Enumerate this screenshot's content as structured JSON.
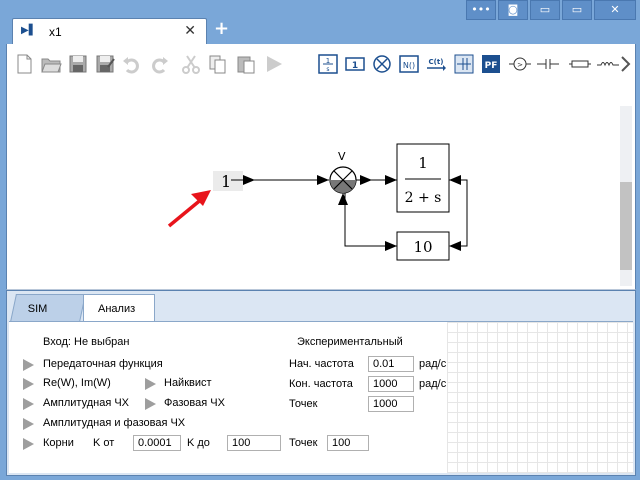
{
  "window": {
    "tab_icon": "▶▌",
    "tab_title": "x1",
    "tab_close": "✕",
    "new_tab": "+",
    "buttons": [
      "•••",
      "◙",
      "▭",
      "▭",
      "✕"
    ]
  },
  "diagram": {
    "input_value": "1",
    "sum_label": "V",
    "tf_numerator": "1",
    "tf_denominator": "2 + s",
    "feedback_gain": "10"
  },
  "tabs": {
    "sim": "SIM",
    "analysis": "Анализ"
  },
  "analysis": {
    "input_label": "Вход: Не выбран",
    "experimental_label": "Экспериментальный",
    "transfer_function": "Передаточная функция",
    "re_im": "Re(W), Im(W)",
    "nyquist": "Найквист",
    "amplitude": "Амплитудная ЧХ",
    "phase": "Фазовая ЧХ",
    "amplitude_phase": "Амплитудная и фазовая ЧХ",
    "roots": "Корни",
    "k_from_label": "K от",
    "k_from_value": "0.0001",
    "k_to_label": "K до",
    "k_to_value": "100",
    "roots_points_label": "Точек",
    "roots_points_value": "100",
    "start_freq_label": "Нач. частота",
    "start_freq_value": "0.01",
    "start_freq_unit": "рад/с",
    "end_freq_label": "Кон. частота",
    "end_freq_value": "1000",
    "end_freq_unit": "рад/с",
    "points_label": "Точек",
    "points_value": "1000"
  },
  "icons": [
    "new-file-icon",
    "open-folder-icon",
    "save-icon",
    "save-as-icon",
    "undo-icon",
    "redo-icon",
    "cut-icon",
    "copy-icon",
    "paste-icon",
    "run-icon",
    "transfer-function-block-icon",
    "gain-block-icon",
    "sum-block-icon",
    "nonlinear-block-icon",
    "signal-source-icon",
    "sampler-icon",
    "pf-block-icon",
    "comparator-icon",
    "capacitor-icon",
    "resistor-icon",
    "inductor-icon",
    "more-icon"
  ],
  "colors": {
    "titlebar": "#7aa7d8",
    "accent": "#1c4f8f",
    "arrow": "#e8141b"
  }
}
